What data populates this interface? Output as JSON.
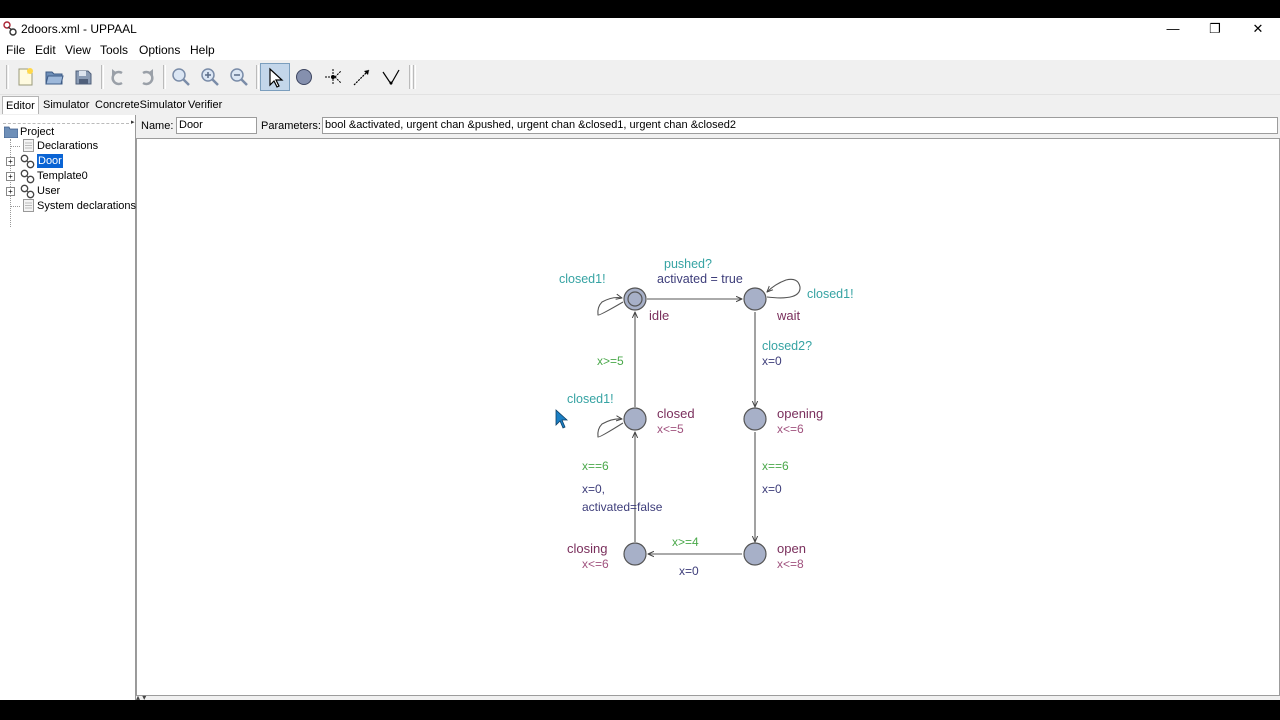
{
  "window": {
    "title": "2doors.xml - UPPAAL"
  },
  "window_controls": {
    "minimize": "—",
    "restore": "❐",
    "close": "✕"
  },
  "menu": [
    "File",
    "Edit",
    "View",
    "Tools",
    "Options",
    "Help"
  ],
  "toolbar_icons": [
    "new-document-icon",
    "open-folder-icon",
    "save-icon",
    "undo-icon",
    "redo-icon",
    "zoom-fit-icon",
    "zoom-in-icon",
    "zoom-out-icon",
    "select-tool-icon",
    "location-tool-icon",
    "branchpoint-tool-icon",
    "edge-tool-icon",
    "nail-tool-icon"
  ],
  "tabs": [
    "Editor",
    "Simulator",
    "ConcreteSimulator",
    "Verifier"
  ],
  "tree": {
    "project": "Project",
    "items": [
      "Declarations",
      "Door",
      "Template0",
      "User",
      "System declarations"
    ]
  },
  "template": {
    "name_label": "Name:",
    "name_value": "Door",
    "params_label": "Parameters:",
    "params_value": "bool &activated, urgent chan &pushed, urgent chan &closed1, urgent chan &closed2"
  },
  "automaton": {
    "colors": {
      "location_fill": "#a7b0c8",
      "sync": "#36a3a3",
      "guard": "#4aa84a",
      "update": "#3d3d7a",
      "name": "#7a2f5c",
      "invariant": "#a0527e"
    },
    "locations": {
      "idle": {
        "name": "idle",
        "invariant": ""
      },
      "wait": {
        "name": "wait",
        "invariant": ""
      },
      "closed": {
        "name": "closed",
        "invariant": "x<=5"
      },
      "opening": {
        "name": "opening",
        "invariant": "x<=6"
      },
      "closing": {
        "name": "closing",
        "invariant": "x<=6"
      },
      "open": {
        "name": "open",
        "invariant": "x<=8"
      }
    },
    "labels": {
      "idle_self_sync": "closed1!",
      "idle_wait_sync": "pushed?",
      "idle_wait_update": "activated = true",
      "wait_self_sync": "closed1!",
      "wait_opening_sync": "closed2?",
      "wait_opening_update": "x=0",
      "closed_idle_guard": "x>=5",
      "closed_self_sync": "closed1!",
      "opening_open_guard": "x==6",
      "opening_open_update": "x=0",
      "closing_closed_guard": "x==6",
      "closing_closed_update_1": "x=0,",
      "closing_closed_update_2": "activated=false",
      "open_closing_guard": "x>=4",
      "open_closing_update": "x=0"
    }
  }
}
